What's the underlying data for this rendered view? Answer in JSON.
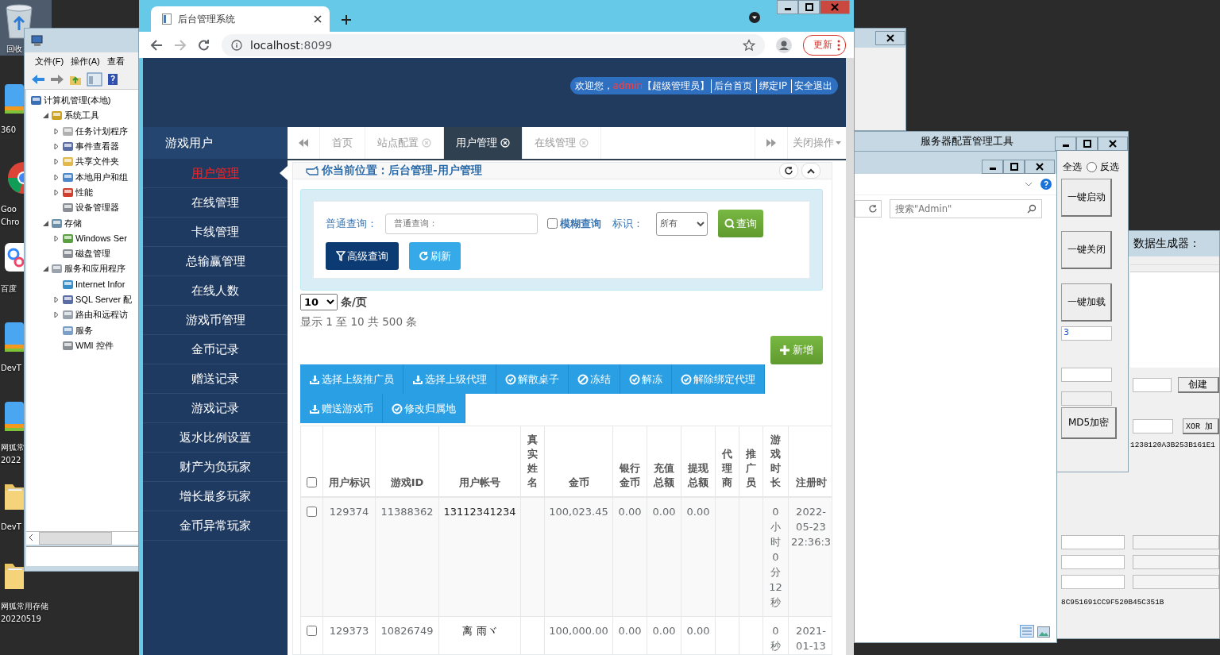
{
  "desktop_icons": [
    {
      "kind": "recycle",
      "lines": [
        "回收"
      ],
      "selected": true
    },
    {
      "kind": "stack",
      "lines": [
        "360"
      ],
      "selected": false
    },
    {
      "kind": "chrome",
      "lines": [
        "Goo",
        "Chro"
      ],
      "selected": false
    },
    {
      "kind": "baidu",
      "lines": [
        "百度"
      ],
      "selected": false
    },
    {
      "kind": "stack",
      "lines": [
        "DevT"
      ],
      "selected": false
    },
    {
      "kind": "stack",
      "lines": [
        "网狐常",
        "2022"
      ],
      "selected": false
    },
    {
      "kind": "folder",
      "lines": [
        "DevT"
      ],
      "selected": false
    },
    {
      "kind": "folder",
      "lines": [
        "网狐常用存储",
        "20220519"
      ],
      "selected": false
    }
  ],
  "computer_management": {
    "menu": [
      "文件(F)",
      "操作(A)",
      "查看"
    ],
    "tree": [
      {
        "label": "计算机管理(本地)",
        "kind": "computer",
        "children": [
          {
            "label": "系统工具",
            "kind": "tools",
            "expanded": true,
            "children": [
              {
                "label": "任务计划程序",
                "kind": "clock",
                "expanded": false
              },
              {
                "label": "事件查看器",
                "kind": "book",
                "expanded": false
              },
              {
                "label": "共享文件夹",
                "kind": "folder",
                "expanded": false
              },
              {
                "label": "本地用户和组",
                "kind": "users",
                "expanded": false
              },
              {
                "label": "性能",
                "kind": "gauge",
                "expanded": false
              },
              {
                "label": "设备管理器",
                "kind": "device"
              }
            ]
          },
          {
            "label": "存储",
            "kind": "drive",
            "expanded": true,
            "children": [
              {
                "label": "Windows Ser",
                "kind": "backup",
                "expanded": false
              },
              {
                "label": "磁盘管理",
                "kind": "device"
              }
            ]
          },
          {
            "label": "服务和应用程序",
            "kind": "server",
            "expanded": true,
            "children": [
              {
                "label": "Internet Infor",
                "kind": "globe"
              },
              {
                "label": "SQL Server 配",
                "kind": "book",
                "expanded": false
              },
              {
                "label": "路由和远程访",
                "kind": "server",
                "expanded": false
              },
              {
                "label": "服务",
                "kind": "gear"
              },
              {
                "label": "WMI 控件",
                "kind": "device"
              }
            ]
          }
        ]
      }
    ]
  },
  "browser": {
    "tab_title": "后台管理系统",
    "url_host": "localhost",
    "url_port": ":8099",
    "update_button": "更新",
    "header": {
      "welcome": "欢迎您，",
      "user": "admin",
      "role": "【超级管理员】",
      "links": [
        "后台首页",
        "绑定IP",
        "安全退出"
      ]
    },
    "sidebar": {
      "title": "游戏用户",
      "items": [
        {
          "label": "用户管理",
          "selected": true
        },
        {
          "label": "在线管理",
          "selected": false
        },
        {
          "label": "卡线管理",
          "selected": false
        },
        {
          "label": "总输赢管理",
          "selected": false
        },
        {
          "label": "在线人数",
          "selected": false
        },
        {
          "label": "游戏币管理",
          "selected": false
        },
        {
          "label": "金币记录",
          "selected": false
        },
        {
          "label": "赠送记录",
          "selected": false
        },
        {
          "label": "游戏记录",
          "selected": false
        },
        {
          "label": "返水比例设置",
          "selected": false
        },
        {
          "label": "财产为负玩家",
          "selected": false
        },
        {
          "label": "增长最多玩家",
          "selected": false
        },
        {
          "label": "金币异常玩家",
          "selected": false
        }
      ]
    },
    "tabs": [
      {
        "label": "首页",
        "closable": false,
        "selected": false
      },
      {
        "label": "站点配置",
        "closable": true,
        "selected": false
      },
      {
        "label": "用户管理",
        "closable": true,
        "selected": true
      },
      {
        "label": "在线管理",
        "closable": true,
        "selected": false
      }
    ],
    "close_menu": "关闭操作",
    "breadcrumb": "你当前位置：后台管理-用户管理",
    "search": {
      "label": "普通查询：",
      "placeholder": "普通查询：",
      "fuzzy": {
        "label": "模糊查询",
        "checked": false
      },
      "flag_label": "标识：",
      "flag_value": "所有",
      "query_button": "查询",
      "advanced_button": "高级查询",
      "refresh_button": "刷新"
    },
    "page_size": "10",
    "page_size_unit": "条/页",
    "summary": "显示 1 至 10 共 500 条",
    "add_button": "新增",
    "actions": [
      {
        "label": "选择上级推广员",
        "kind": "upload"
      },
      {
        "label": "选择上级代理",
        "kind": "upload"
      },
      {
        "label": "解散桌子",
        "kind": "check"
      },
      {
        "label": "冻结",
        "kind": "ban"
      },
      {
        "label": "解冻",
        "kind": "check"
      },
      {
        "label": "解除绑定代理",
        "kind": "check"
      },
      {
        "label": "赠送游戏币",
        "kind": "upload"
      },
      {
        "label": "修改归属地",
        "kind": "check"
      }
    ],
    "table": {
      "header_checked": false,
      "columns": [
        "用户标识",
        "游戏ID",
        "用户帐号",
        "真实姓名",
        "金币",
        "银行金币",
        "充值总额",
        "提现总额",
        "代理商",
        "推广员",
        "游戏时长",
        "注册时"
      ],
      "rows": [
        {
          "checked": false,
          "cells": [
            "129374",
            "11388362",
            "13112341234",
            "",
            "100,023.45",
            "0.00",
            "0.00",
            "0.00",
            "",
            "",
            "0小时0分12秒",
            "2022-05-23 22:36:3"
          ]
        },
        {
          "checked": false,
          "cells": [
            "129373",
            "10826749",
            "离 雨ヾ",
            "",
            "100,000.00",
            "0.00",
            "0.00",
            "0.00",
            "",
            "",
            "0秒",
            "2021-01-13"
          ]
        }
      ]
    }
  },
  "server_tool": {
    "title": "服务器配置管理工具",
    "radios": [
      {
        "label": "全选"
      },
      {
        "label": "反选",
        "selected": false
      }
    ],
    "buttons": [
      "一键启动",
      "一键关闭",
      "一键加载"
    ],
    "field_value": "3",
    "md5_button": "MD5加密"
  },
  "explorer": {
    "search_placeholder": "搜索\"Admin\""
  },
  "data_generator": {
    "title": "数据生成器：",
    "create_button": "创建",
    "xor_button": "XOR 加",
    "hex_1": "1238120A3B253B161E1",
    "hex_2": "8C951691CC9F520B45C351B"
  }
}
